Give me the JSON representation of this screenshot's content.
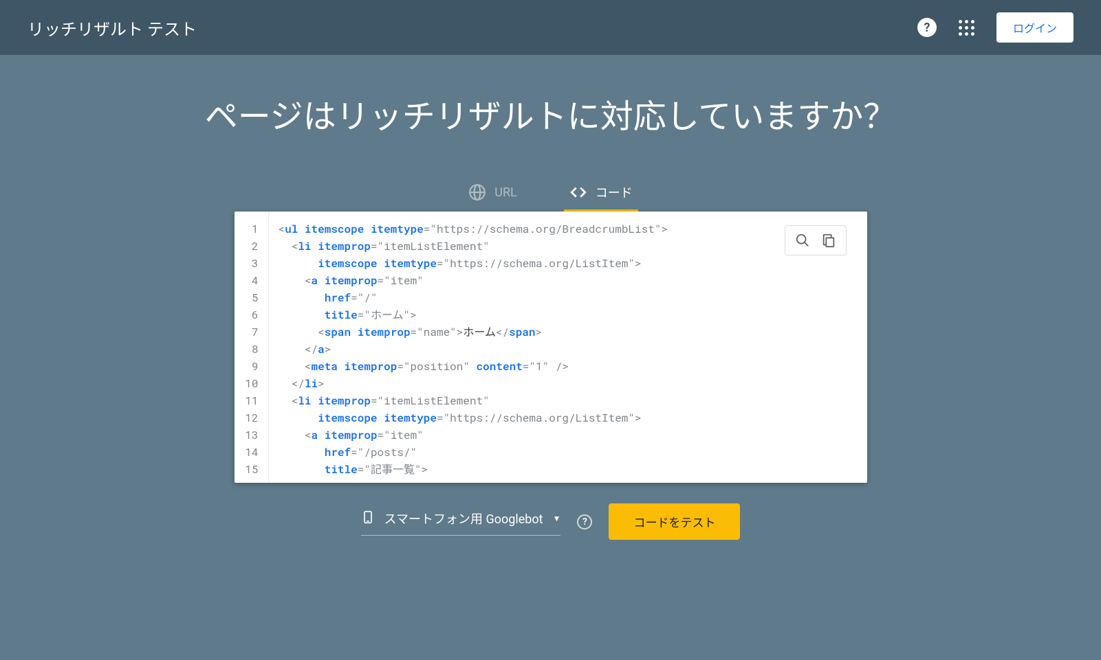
{
  "header": {
    "title": "リッチリザルト テスト",
    "login_label": "ログイン"
  },
  "main": {
    "heading": "ページはリッチリザルトに対応していますか？"
  },
  "tabs": {
    "url_label": "URL",
    "code_label": "コード"
  },
  "code": {
    "lines": [
      {
        "n": "1",
        "indent": "",
        "parts": [
          [
            "punct",
            "<"
          ],
          [
            "tag",
            "ul"
          ],
          [
            "txt",
            " "
          ],
          [
            "attr",
            "itemscope"
          ],
          [
            "txt",
            " "
          ],
          [
            "attr",
            "itemtype"
          ],
          [
            "punct",
            "="
          ],
          [
            "val",
            "\"https://schema.org/BreadcrumbList\""
          ],
          [
            "punct",
            ">"
          ]
        ]
      },
      {
        "n": "2",
        "indent": "  ",
        "parts": [
          [
            "punct",
            "<"
          ],
          [
            "tag",
            "li"
          ],
          [
            "txt",
            " "
          ],
          [
            "attr",
            "itemprop"
          ],
          [
            "punct",
            "="
          ],
          [
            "val",
            "\"itemListElement\""
          ]
        ]
      },
      {
        "n": "3",
        "indent": "      ",
        "parts": [
          [
            "attr",
            "itemscope"
          ],
          [
            "txt",
            " "
          ],
          [
            "attr",
            "itemtype"
          ],
          [
            "punct",
            "="
          ],
          [
            "val",
            "\"https://schema.org/ListItem\""
          ],
          [
            "punct",
            ">"
          ]
        ]
      },
      {
        "n": "4",
        "indent": "    ",
        "parts": [
          [
            "punct",
            "<"
          ],
          [
            "tag",
            "a"
          ],
          [
            "txt",
            " "
          ],
          [
            "attr",
            "itemprop"
          ],
          [
            "punct",
            "="
          ],
          [
            "val",
            "\"item\""
          ]
        ]
      },
      {
        "n": "5",
        "indent": "       ",
        "parts": [
          [
            "attr",
            "href"
          ],
          [
            "punct",
            "="
          ],
          [
            "val",
            "\"/\""
          ]
        ]
      },
      {
        "n": "6",
        "indent": "       ",
        "parts": [
          [
            "attr",
            "title"
          ],
          [
            "punct",
            "="
          ],
          [
            "val",
            "\"ホーム\""
          ],
          [
            "punct",
            ">"
          ]
        ]
      },
      {
        "n": "7",
        "indent": "      ",
        "parts": [
          [
            "punct",
            "<"
          ],
          [
            "tag",
            "span"
          ],
          [
            "txt",
            " "
          ],
          [
            "attr",
            "itemprop"
          ],
          [
            "punct",
            "="
          ],
          [
            "val",
            "\"name\""
          ],
          [
            "punct",
            ">"
          ],
          [
            "txt",
            "ホーム"
          ],
          [
            "punct",
            "</"
          ],
          [
            "tag",
            "span"
          ],
          [
            "punct",
            ">"
          ]
        ]
      },
      {
        "n": "8",
        "indent": "    ",
        "parts": [
          [
            "punct",
            "</"
          ],
          [
            "tag",
            "a"
          ],
          [
            "punct",
            ">"
          ]
        ]
      },
      {
        "n": "9",
        "indent": "    ",
        "parts": [
          [
            "punct",
            "<"
          ],
          [
            "tag",
            "meta"
          ],
          [
            "txt",
            " "
          ],
          [
            "attr",
            "itemprop"
          ],
          [
            "punct",
            "="
          ],
          [
            "val",
            "\"position\""
          ],
          [
            "txt",
            " "
          ],
          [
            "attr",
            "content"
          ],
          [
            "punct",
            "="
          ],
          [
            "val",
            "\"1\""
          ],
          [
            "txt",
            " "
          ],
          [
            "punct",
            "/>"
          ]
        ]
      },
      {
        "n": "10",
        "indent": "  ",
        "parts": [
          [
            "punct",
            "</"
          ],
          [
            "tag",
            "li"
          ],
          [
            "punct",
            ">"
          ]
        ]
      },
      {
        "n": "11",
        "indent": "  ",
        "parts": [
          [
            "punct",
            "<"
          ],
          [
            "tag",
            "li"
          ],
          [
            "txt",
            " "
          ],
          [
            "attr",
            "itemprop"
          ],
          [
            "punct",
            "="
          ],
          [
            "val",
            "\"itemListElement\""
          ]
        ]
      },
      {
        "n": "12",
        "indent": "      ",
        "parts": [
          [
            "attr",
            "itemscope"
          ],
          [
            "txt",
            " "
          ],
          [
            "attr",
            "itemtype"
          ],
          [
            "punct",
            "="
          ],
          [
            "val",
            "\"https://schema.org/ListItem\""
          ],
          [
            "punct",
            ">"
          ]
        ]
      },
      {
        "n": "13",
        "indent": "    ",
        "parts": [
          [
            "punct",
            "<"
          ],
          [
            "tag",
            "a"
          ],
          [
            "txt",
            " "
          ],
          [
            "attr",
            "itemprop"
          ],
          [
            "punct",
            "="
          ],
          [
            "val",
            "\"item\""
          ]
        ]
      },
      {
        "n": "14",
        "indent": "       ",
        "parts": [
          [
            "attr",
            "href"
          ],
          [
            "punct",
            "="
          ],
          [
            "val",
            "\"/posts/\""
          ]
        ]
      },
      {
        "n": "15",
        "indent": "       ",
        "parts": [
          [
            "attr",
            "title"
          ],
          [
            "punct",
            "="
          ],
          [
            "val",
            "\"記事一覧\""
          ],
          [
            "punct",
            ">"
          ]
        ]
      }
    ]
  },
  "footer": {
    "bot_label": "スマートフォン用 Googlebot",
    "test_button_label": "コードをテスト"
  }
}
